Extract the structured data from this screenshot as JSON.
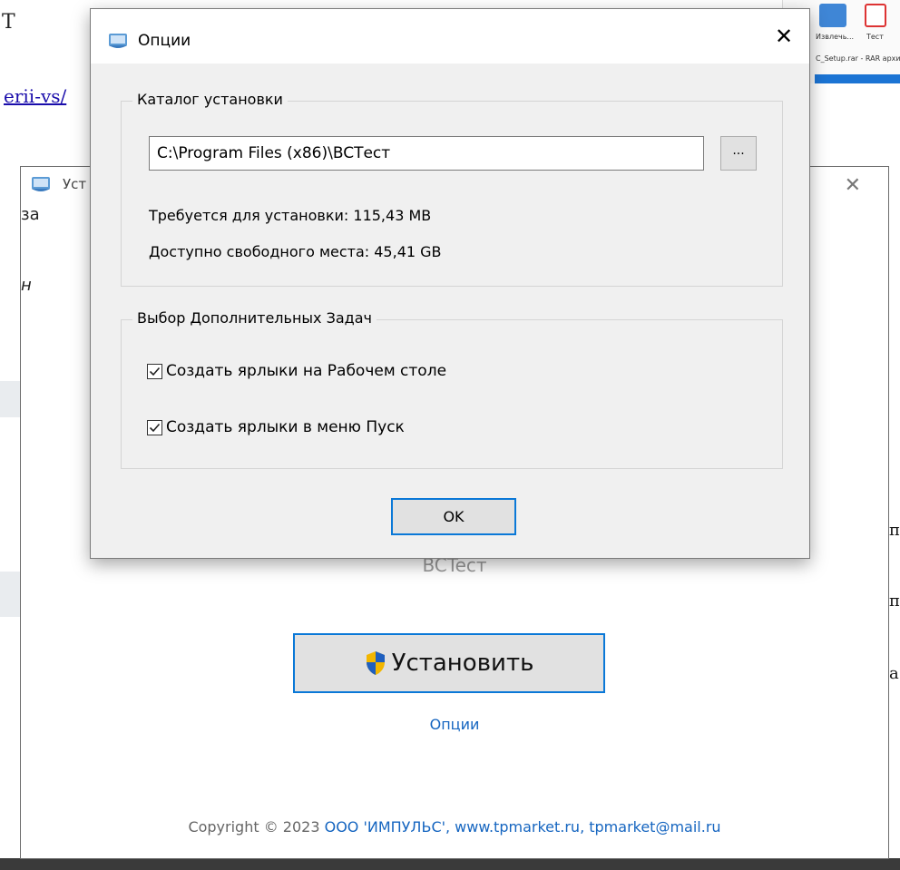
{
  "background": {
    "left_text": "Т",
    "link_text": "erii-vs/",
    "main_left_fragments": [
      "за",
      "н"
    ],
    "right_fragments": [
      "п",
      "п",
      "а"
    ],
    "taskbar": {
      "items": [
        {
          "label": "Извлечь...",
          "icon": "folder-icon",
          "color": "#3f86d6"
        },
        {
          "label": "Тест",
          "icon": "test-icon",
          "color": "#d33"
        }
      ],
      "caption": "C_Setup.rar - RAR архив"
    }
  },
  "main_window": {
    "title": "Уст",
    "product_name": "BCTecт",
    "install_button": "Установить",
    "options_link": "Опции",
    "footer": {
      "copyright": "Copyright © 2023",
      "links": "ООО 'ИМПУЛЬС', www.tpmarket.ru, tpmarket@mail.ru"
    }
  },
  "options_dialog": {
    "title": "Опции",
    "install_dir": {
      "legend": "Каталог установки",
      "path": "C:\\Program Files (x86)\\BCTест",
      "browse_label": "...",
      "required": "Требуется для установки: 115,43 MB",
      "available": "Доступно свободного места: 45,41 GB"
    },
    "tasks": {
      "legend": "Выбор Дополнительных Задач",
      "items": [
        {
          "label": "Создать ярлыки на Рабочем столе",
          "checked": true
        },
        {
          "label": "Создать ярлыки в меню Пуск",
          "checked": true
        }
      ]
    },
    "ok_label": "OK"
  },
  "colors": {
    "accent_border": "#0a78d7",
    "link_blue": "#1565c0",
    "dialog_bg": "#f0f0f0",
    "button_bg": "#e1e1e1"
  }
}
